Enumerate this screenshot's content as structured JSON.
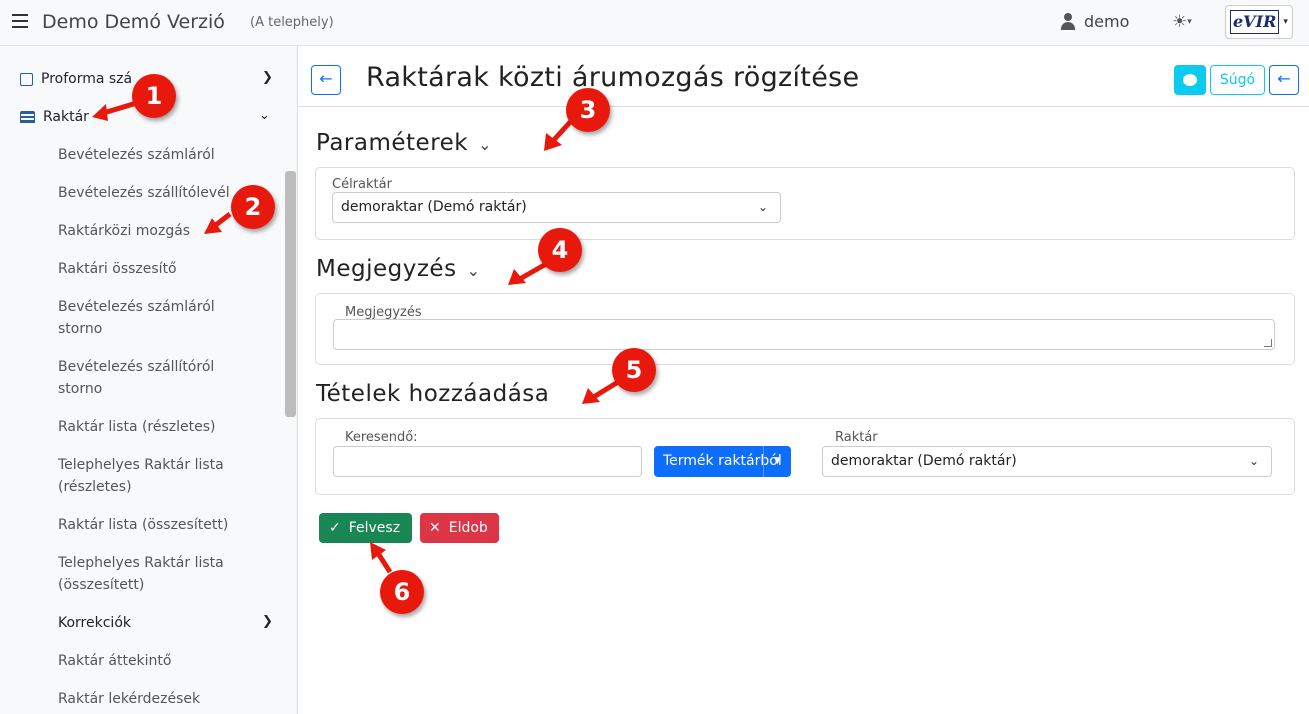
{
  "topbar": {
    "title": "Demo Demó Verzió",
    "subtitle": "(A telephely)",
    "user": "demo",
    "logo_text": "eVIR"
  },
  "sidebar": {
    "items": [
      {
        "label": "Proforma szá"
      },
      {
        "label": "Raktár"
      }
    ],
    "subitems": [
      "Bevételezés számláról",
      "Bevételezés szállítólevél",
      "Raktárközi mozgás",
      "Raktári összesítő",
      "Bevételezés számláról storno",
      "Bevételezés szállítóról storno",
      "Raktár lista (részletes)",
      "Telephelyes Raktár lista (részletes)",
      "Raktár lista (összesített)",
      "Telephelyes Raktár lista (összesített)",
      "Korrekciók",
      "Raktár áttekintő",
      "Raktár lekérdezések"
    ]
  },
  "header": {
    "title": "Raktárak közti árumozgás rögzítése",
    "help_label": "Súgó"
  },
  "sections": {
    "params": {
      "title": "Paraméterek",
      "target_label": "Célraktár",
      "target_value": "demoraktar (Demó raktár)"
    },
    "note": {
      "title": "Megjegyzés",
      "field_label": "Megjegyzés"
    },
    "items": {
      "title": "Tételek hozzáadása",
      "search_label": "Keresendő:",
      "product_button": "Termék raktárból",
      "warehouse_label": "Raktár",
      "warehouse_value": "demoraktar (Demó raktár)"
    }
  },
  "actions": {
    "add_label": "Felvesz",
    "discard_label": "Eldob"
  },
  "markers": [
    "1",
    "2",
    "3",
    "4",
    "5",
    "6"
  ],
  "colors": {
    "primary": "#0d6efd",
    "info": "#0dcaf0",
    "success": "#198754",
    "danger": "#dc3545",
    "marker": "#e8180c"
  }
}
